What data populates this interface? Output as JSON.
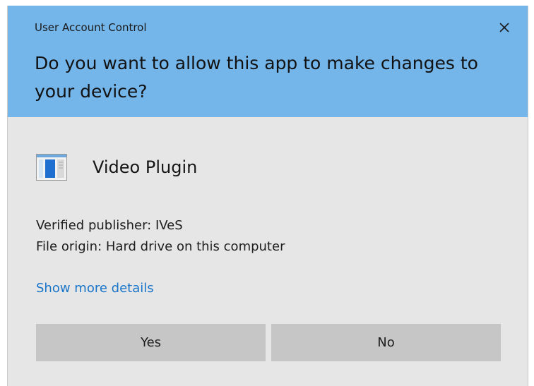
{
  "dialog": {
    "title": "User Account Control",
    "question": "Do you want to allow this app to make changes to your device?",
    "close_icon": "close-icon",
    "header_color": "#74b5ea"
  },
  "app": {
    "icon": "app-window-icon",
    "name": "Video Plugin"
  },
  "info": {
    "publisher": "Verified publisher: IVeS",
    "origin": "File origin: Hard drive on this computer"
  },
  "links": {
    "details": "Show more details",
    "link_color": "#1a75c9"
  },
  "buttons": {
    "yes": "Yes",
    "no": "No"
  }
}
